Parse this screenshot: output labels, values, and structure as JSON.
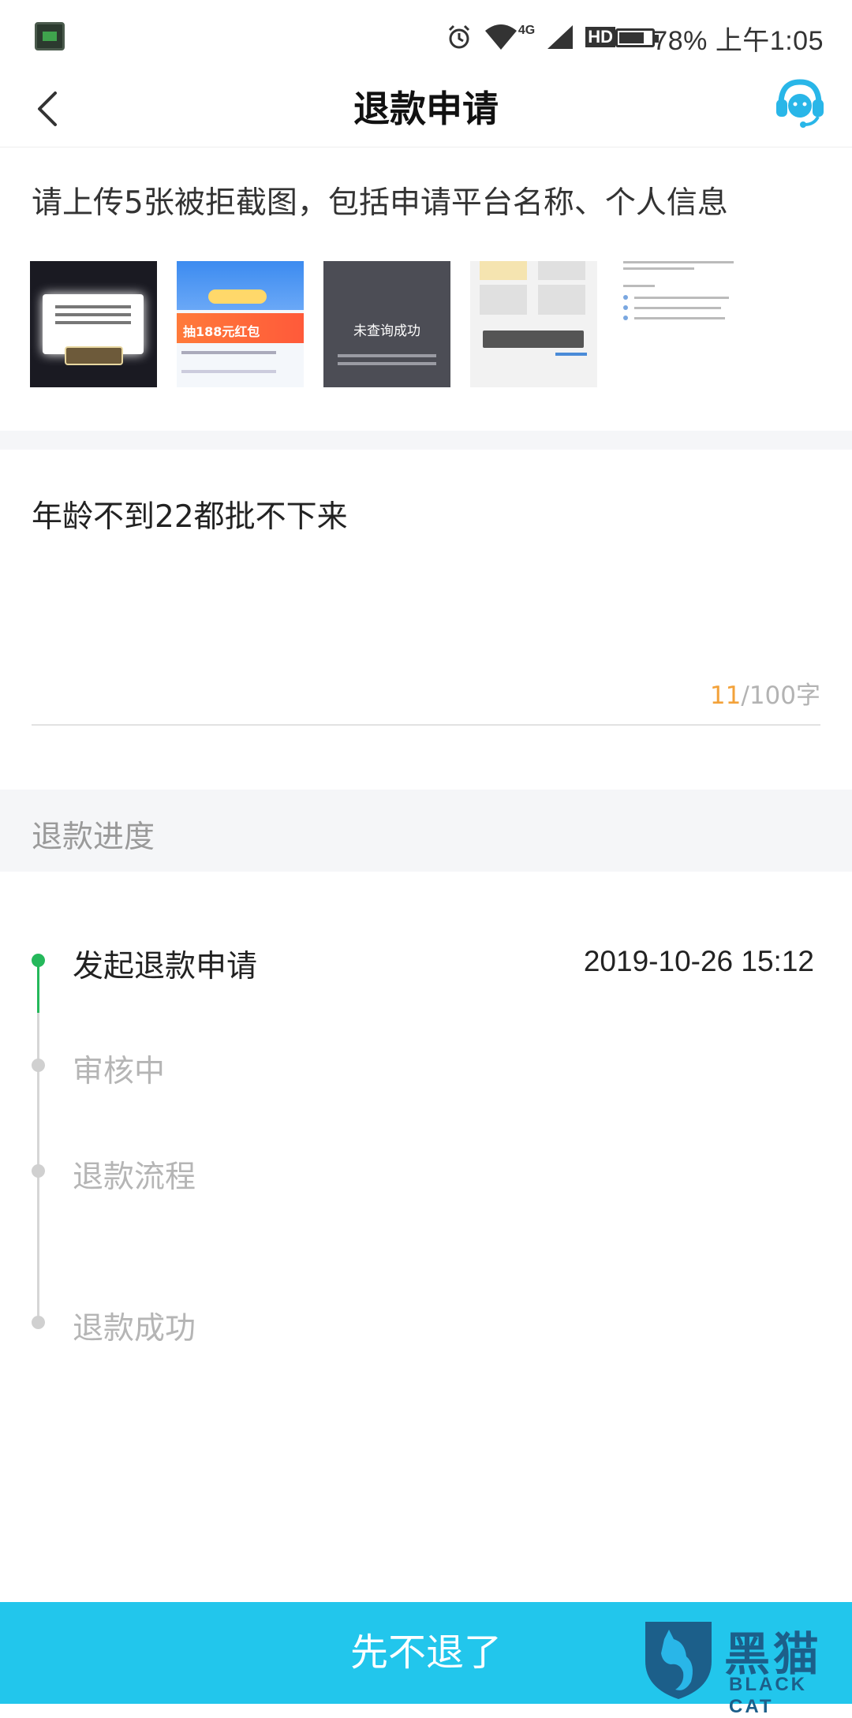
{
  "status_bar": {
    "signal_label": "4G",
    "hd_label": "HD",
    "battery_percent": 78,
    "battery_text": "78%",
    "time": "上午1:05"
  },
  "header": {
    "title": "退款申请",
    "back_icon": "chevron-left-icon",
    "service_icon": "headset-icon",
    "accent_color": "#29b6e8"
  },
  "upload": {
    "hint": "请上传5张被拒截图，包括申请平台名称、个人信息",
    "thumbnails": [
      {
        "name": "screenshot-1"
      },
      {
        "name": "screenshot-2",
        "text": "抽188元红包"
      },
      {
        "name": "screenshot-3",
        "text": "未查询成功"
      },
      {
        "name": "screenshot-4"
      },
      {
        "name": "screenshot-5"
      }
    ]
  },
  "reason": {
    "text": "年龄不到22都批不下来",
    "count_current": "11",
    "count_max": "/100字"
  },
  "progress": {
    "title": "退款进度",
    "steps": [
      {
        "label": "发起退款申请",
        "time": "2019-10-26 15:12",
        "active": true
      },
      {
        "label": "审核中",
        "active": false
      },
      {
        "label": "退款流程",
        "active": false
      },
      {
        "label": "退款成功",
        "active": false
      }
    ],
    "active_color": "#25b85b"
  },
  "footer": {
    "button_label": "先不退了",
    "button_color": "#22c6ec"
  },
  "watermark": {
    "cn": "黑猫",
    "en": "BLACK CAT"
  }
}
